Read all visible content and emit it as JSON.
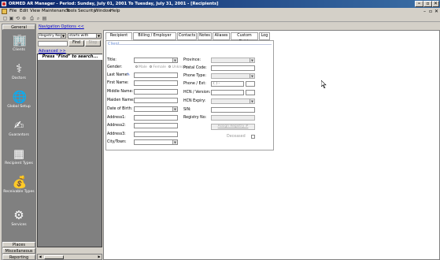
{
  "window": {
    "title": "ORMED AR Manager - Period: Sunday, July 01, 2001 To Tuesday, July 31, 2001 - [Recipients]",
    "buttons": [
      "–",
      "▫",
      "✕"
    ],
    "mdi_buttons": [
      "–",
      "▫",
      "✕"
    ]
  },
  "menu": [
    "File",
    "Edit",
    "View",
    "Maintenance",
    "Tools",
    "Security",
    "Window",
    "Help"
  ],
  "sidebar": {
    "top_tab": "General",
    "items": [
      {
        "label": "Clients",
        "icon": "clients-icon",
        "glyph": "🏢"
      },
      {
        "label": "Doctors",
        "icon": "doctors-icon",
        "glyph": "⚕"
      },
      {
        "label": "Global Setup",
        "icon": "global-setup-icon",
        "glyph": "🌐"
      },
      {
        "label": "Guarantors",
        "icon": "guarantors-icon",
        "glyph": "✍"
      },
      {
        "label": "Recipient Types",
        "icon": "recipient-types-icon",
        "glyph": "▦"
      },
      {
        "label": "Receivable Types",
        "icon": "receivable-types-icon",
        "glyph": "💰"
      },
      {
        "label": "Services",
        "icon": "services-icon",
        "glyph": "⚙"
      }
    ],
    "bottom_tabs": [
      "Places",
      "Miscellaneous",
      "Reporting"
    ]
  },
  "nav": {
    "options_link": "Navigation Options <<",
    "field_select": "Registry No",
    "match_select": "starts with",
    "find_button": "Find",
    "stop_button": "Stop",
    "advanced_link": "Advanced >>",
    "hint": "Press \"Find\" to search..."
  },
  "tabs": [
    "Recipient",
    "Billing / Employer",
    "Contacts",
    "Notes",
    "Aliases",
    "Custom Fields",
    "Log"
  ],
  "form": {
    "section": "Client",
    "left_labels": [
      "Title:",
      "Gender:",
      "Last Name:",
      "First Name:",
      "Middle Name:",
      "Maiden Name:",
      "Date of Birth:",
      "Address1:",
      "Address2:",
      "Address3:",
      "City/Town:"
    ],
    "gender_options": [
      "Male",
      "Female",
      "Unknown"
    ],
    "right_labels": [
      "Province:",
      "Postal Code:",
      "Phone Type:",
      "Phone / Ext:",
      "HCN / Version:",
      "HCN Expiry:",
      "SIN:",
      "Registry No:"
    ],
    "phone_placeholder": "(   )     -",
    "assign_button": "Assign Registry #",
    "deceased_label": "Deceased"
  }
}
